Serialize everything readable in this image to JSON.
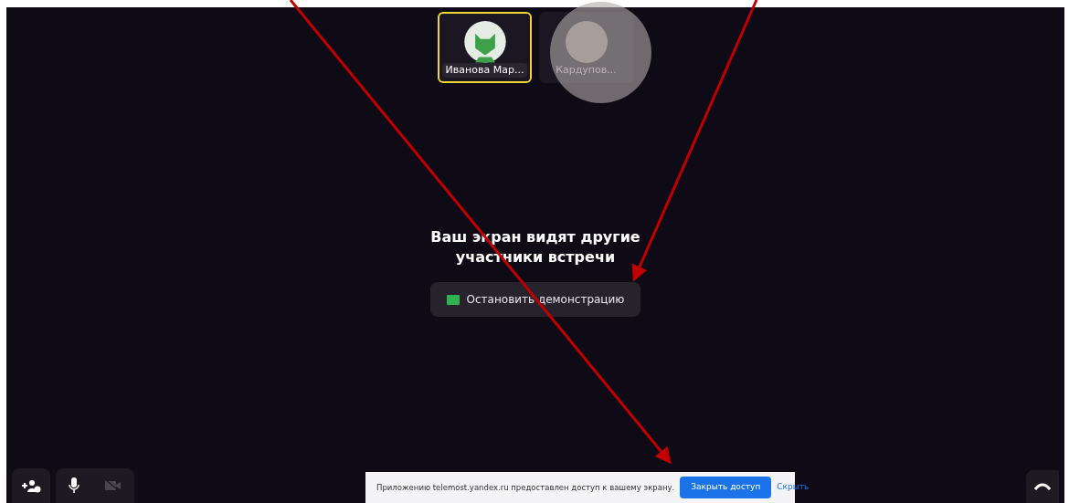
{
  "participants": [
    {
      "name": "Иванова Мар...",
      "selected": true,
      "kind": "fox"
    },
    {
      "name": "Кардупов...",
      "selected": false,
      "kind": "photo"
    }
  ],
  "sharing": {
    "message": "Ваш экран видят другие участники встречи",
    "stop_button": "Остановить демонстрацию"
  },
  "controls": {
    "microphone_on": true,
    "camera_on": false
  },
  "notification": {
    "text": "Приложению telemost.yandex.ru предоставлен доступ к вашему экрану.",
    "primary_button": "Закрыть доступ",
    "link": "Скрыть"
  }
}
